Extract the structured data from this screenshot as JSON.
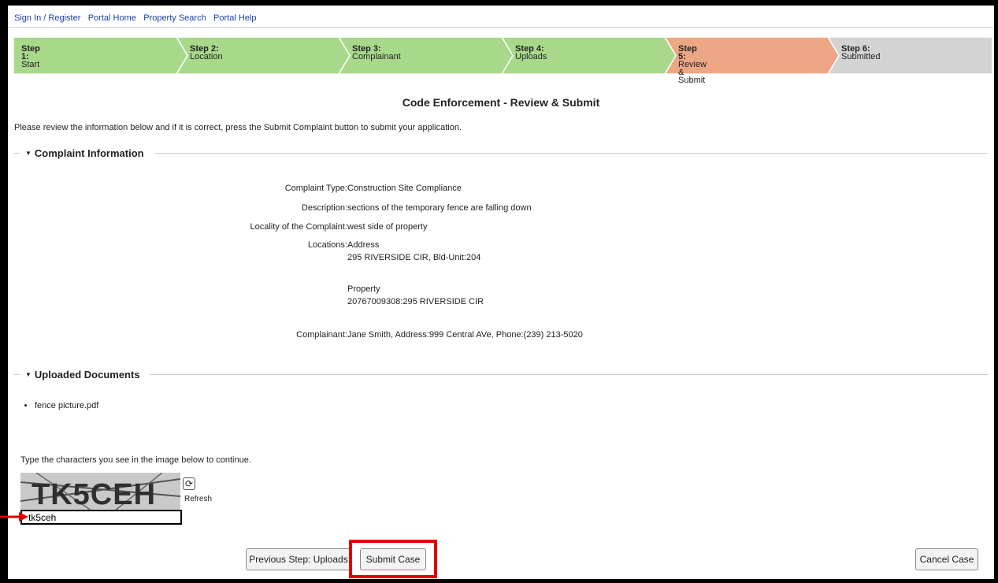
{
  "nav": {
    "links": [
      "Sign In / Register",
      "Portal Home",
      "Property Search",
      "Portal Help"
    ]
  },
  "steps": [
    {
      "num": "Step 1:",
      "label": "Start",
      "state": "done"
    },
    {
      "num": "Step 2:",
      "label": "Location",
      "state": "done"
    },
    {
      "num": "Step 3:",
      "label": "Complainant",
      "state": "done"
    },
    {
      "num": "Step 4:",
      "label": "Uploads",
      "state": "done"
    },
    {
      "num": "Step 5:",
      "label": "Review & Submit",
      "state": "current"
    },
    {
      "num": "Step 6:",
      "label": "Submitted",
      "state": "pending"
    }
  ],
  "colors": {
    "done": "#a8d98b",
    "current": "#eda785",
    "pending": "#d3d3d3",
    "link": "#1a3fa8",
    "highlight": "#e00000"
  },
  "page": {
    "title": "Code Enforcement - Review & Submit",
    "intro": "Please review the information below and if it is correct, press the Submit Complaint button to submit your application."
  },
  "complaint": {
    "section_title": "Complaint Information",
    "type_label": "Complaint Type:",
    "type_value": "Construction Site Compliance",
    "desc_label": "Description:",
    "desc_value": "sections of the temporary fence are falling down",
    "locality_label": "Locality of the Complaint:",
    "locality_value": "west side of property",
    "locations_label": "Locations:",
    "address_heading": "Address",
    "address_value": "295 RIVERSIDE CIR, Bld-Unit:204",
    "property_heading": "Property",
    "property_value": "20767009308:295 RIVERSIDE CIR",
    "complainant_label": "Complainant:",
    "complainant_value": "Jane Smith, Address:999 Central AVe, Phone:(239) 213-5020"
  },
  "documents": {
    "section_title": "Uploaded Documents",
    "items": [
      "fence picture.pdf"
    ]
  },
  "captcha": {
    "prompt": "Type the characters you see in the image below to continue.",
    "image_text": "TK5CEH",
    "refresh_label": "Refresh",
    "input_value": "tk5ceh"
  },
  "buttons": {
    "previous": "Previous Step: Uploads",
    "submit": "Submit Case",
    "cancel": "Cancel Case"
  }
}
